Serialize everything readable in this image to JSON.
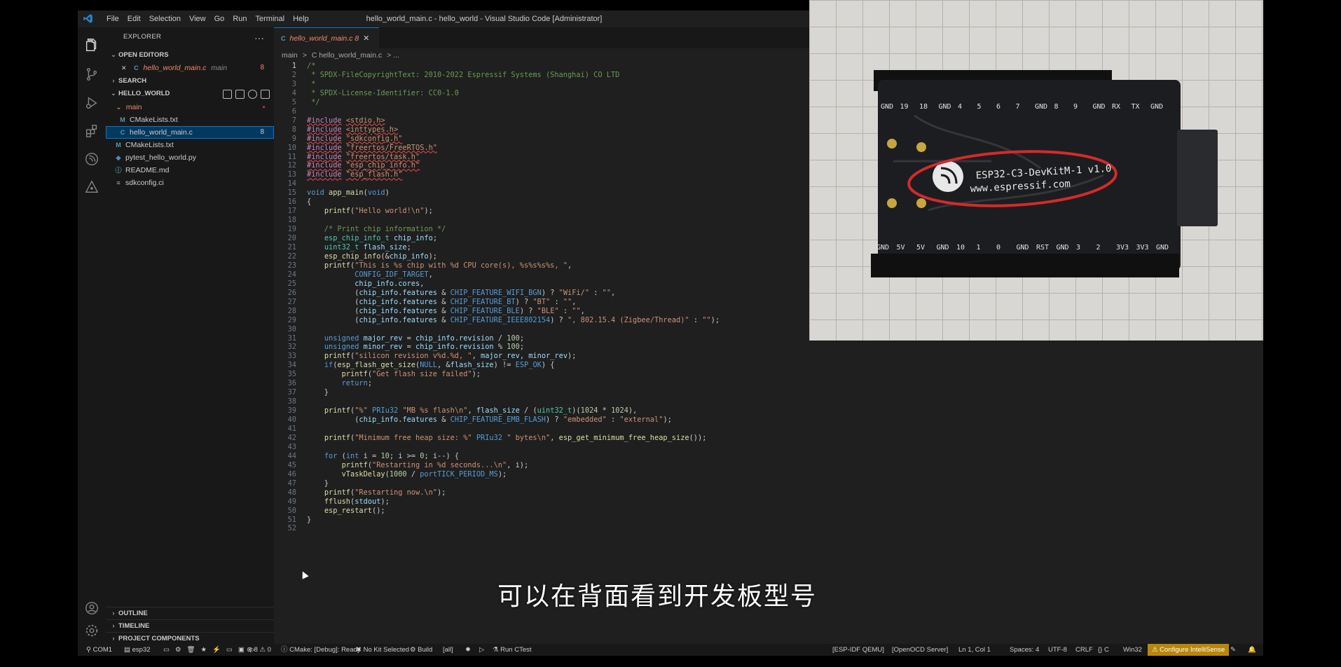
{
  "window": {
    "menu": [
      "File",
      "Edit",
      "Selection",
      "View",
      "Go",
      "Run",
      "Terminal",
      "Help"
    ],
    "title": "hello_world_main.c - hello_world - Visual Studio Code [Administrator]"
  },
  "activity_bar": {
    "icons": [
      "explorer-icon",
      "source-control-icon",
      "run-debug-icon",
      "extensions-icon",
      "espressif-icon",
      "esp-idf-icon",
      "account-icon",
      "settings-gear-icon"
    ]
  },
  "sidebar": {
    "header": "EXPLORER",
    "more": "···",
    "open_editors": {
      "title": "OPEN EDITORS",
      "items": [
        {
          "close": "✕",
          "icon": "C",
          "name": "hello_world_main.c",
          "folder": "main",
          "badge": "8"
        }
      ]
    },
    "search": {
      "title": "SEARCH"
    },
    "hello_world": {
      "title": "HELLO_WORLD",
      "folder": {
        "name": "main"
      },
      "items": [
        {
          "icon": "M",
          "name": "CMakeLists.txt",
          "indent": 2,
          "badge": ""
        },
        {
          "icon": "C",
          "name": "hello_world_main.c",
          "indent": 2,
          "badge": "8",
          "selected": true
        },
        {
          "icon": "M",
          "name": "CMakeLists.txt",
          "indent": 1,
          "badge": ""
        },
        {
          "icon": "◆",
          "name": "pytest_hello_world.py",
          "indent": 1,
          "badge": ""
        },
        {
          "icon": "ⓘ",
          "name": "README.md",
          "indent": 1,
          "badge": ""
        },
        {
          "icon": "≡",
          "name": "sdkconfig.ci",
          "indent": 1,
          "badge": ""
        }
      ]
    },
    "bottom_sections": [
      "OUTLINE",
      "TIMELINE",
      "PROJECT COMPONENTS"
    ]
  },
  "editor": {
    "tab": {
      "icon": "C",
      "label": "hello_world_main.c 8",
      "close": "✕"
    },
    "breadcrumb": [
      "main",
      ">",
      "C hello_world_main.c",
      "> ..."
    ],
    "line_numbers": [
      "1",
      "2",
      "3",
      "4",
      "5",
      "6",
      "7",
      "8",
      "9",
      "10",
      "11",
      "12",
      "13",
      "14",
      "15",
      "16",
      "17",
      "18",
      "19",
      "20",
      "21",
      "22",
      "23",
      "24",
      "25",
      "26",
      "27",
      "28",
      "29",
      "30",
      "31",
      "32",
      "33",
      "34",
      "35",
      "36",
      "37",
      "38",
      "39",
      "40",
      "41",
      "42",
      "43",
      "44",
      "45",
      "46",
      "47",
      "48",
      "49",
      "50",
      "51",
      "52"
    ],
    "code": [
      "/*",
      " * SPDX-FileCopyrightText: 2010-2022 Espressif Systems (Shanghai) CO LTD",
      " *",
      " * SPDX-License-Identifier: CC0-1.0",
      " */",
      "",
      "#include <stdio.h>",
      "#include <inttypes.h>",
      "#include \"sdkconfig.h\"",
      "#include \"freertos/FreeRTOS.h\"",
      "#include \"freertos/task.h\"",
      "#include \"esp_chip_info.h\"",
      "#include \"esp_flash.h\"",
      "",
      "void app_main(void)",
      "{",
      "    printf(\"Hello world!\\n\");",
      "",
      "    /* Print chip information */",
      "    esp_chip_info_t chip_info;",
      "    uint32_t flash_size;",
      "    esp_chip_info(&chip_info);",
      "    printf(\"This is %s chip with %d CPU core(s), %s%s%s%s, \",",
      "           CONFIG_IDF_TARGET,",
      "           chip_info.cores,",
      "           (chip_info.features & CHIP_FEATURE_WIFI_BGN) ? \"WiFi/\" : \"\",",
      "           (chip_info.features & CHIP_FEATURE_BT) ? \"BT\" : \"\",",
      "           (chip_info.features & CHIP_FEATURE_BLE) ? \"BLE\" : \"\",",
      "           (chip_info.features & CHIP_FEATURE_IEEE802154) ? \", 802.15.4 (Zigbee/Thread)\" : \"\");",
      "",
      "    unsigned major_rev = chip_info.revision / 100;",
      "    unsigned minor_rev = chip_info.revision % 100;",
      "    printf(\"silicon revision v%d.%d, \", major_rev, minor_rev);",
      "    if(esp_flash_get_size(NULL, &flash_size) != ESP_OK) {",
      "        printf(\"Get flash size failed\");",
      "        return;",
      "    }",
      "",
      "    printf(\"%\" PRIu32 \"MB %s flash\\n\", flash_size / (uint32_t)(1024 * 1024),",
      "           (chip_info.features & CHIP_FEATURE_EMB_FLASH) ? \"embedded\" : \"external\");",
      "",
      "    printf(\"Minimum free heap size: %\" PRIu32 \" bytes\\n\", esp_get_minimum_free_heap_size());",
      "",
      "    for (int i = 10; i >= 0; i--) {",
      "        printf(\"Restarting in %d seconds...\\n\", i);",
      "        vTaskDelay(1000 / portTICK_PERIOD_MS);",
      "    }",
      "    printf(\"Restarting now.\\n\");",
      "    fflush(stdout);",
      "    esp_restart();",
      "}",
      ""
    ]
  },
  "statusbar": {
    "port": "COM1",
    "target": "esp32",
    "problems": "⊗ 8 ⚠ 0",
    "cmake": "CMake: [Debug]: Ready",
    "kit": "No Kit Selected",
    "build": "Build",
    "all": "[all]",
    "run_ctest": "Run CTest",
    "idf_qemu": "[ESP-IDF QEMU]",
    "openocd": "[OpenOCD Server]",
    "position": "Ln 1, Col 1",
    "spaces": "Spaces: 4",
    "encoding": "UTF-8",
    "eol": "CRLF",
    "language": "{} C",
    "platform": "Win32",
    "intellisense": "⚠ Configure IntelliSense"
  },
  "photo": {
    "board_silk_top": [
      "GND",
      "19",
      "18",
      "GND",
      "4",
      "5",
      "6",
      "7",
      "GND",
      "8",
      "9",
      "GND",
      "RX",
      "TX",
      "GND"
    ],
    "board_silk_bottom": [
      "GND",
      "5V",
      "5V",
      "GND",
      "10",
      "1",
      "0",
      "GND",
      "RST",
      "GND",
      "3",
      "2",
      "3V3",
      "3V3",
      "GND"
    ],
    "board_name": "ESP32-C3-DevKitM-1 v1.0",
    "board_url": "www.espressif.com"
  },
  "subtitle": "可以在背面看到开发板型号"
}
